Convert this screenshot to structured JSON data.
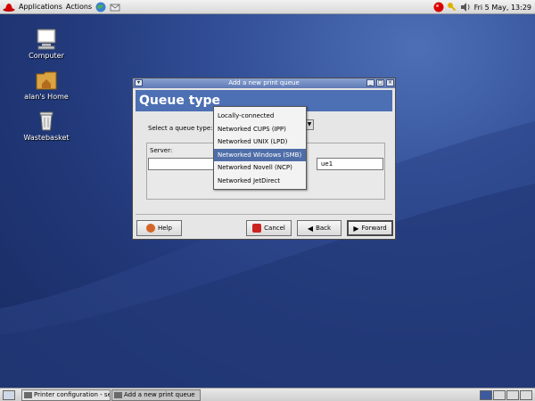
{
  "top_panel": {
    "menus": [
      "Applications",
      "Actions"
    ],
    "clock": "Fri  5 May, 13:29"
  },
  "desktop": {
    "icons": [
      {
        "label": "Computer",
        "icon": "computer-icon"
      },
      {
        "label": "alan's Home",
        "icon": "home-folder-icon"
      },
      {
        "label": "Wastebasket",
        "icon": "trash-icon"
      }
    ]
  },
  "dialog": {
    "title": "Add a new print queue",
    "banner": "Queue type",
    "queue_type_label": "Select a queue type:",
    "server_label": "Server:",
    "queue_partial_value": "ue1",
    "buttons": {
      "help": "Help",
      "cancel": "Cancel",
      "back": "Back",
      "forward": "Forward"
    }
  },
  "queue_type_popup": {
    "options": [
      "Locally-connected",
      "Networked CUPS (IPP)",
      "Networked UNIX (LPD)",
      "Networked Windows (SMB)",
      "Networked Novell (NCP)",
      "Networked JetDirect"
    ],
    "selected_index": 3
  },
  "taskbar": {
    "tasks": [
      {
        "label": "Printer configuration - ser",
        "active": false
      },
      {
        "label": "Add a new print queue",
        "active": true
      }
    ]
  },
  "colors": {
    "banner": "#4d6fb3",
    "selection": "#4f6ea8",
    "titlebar": "#6b86c0"
  }
}
